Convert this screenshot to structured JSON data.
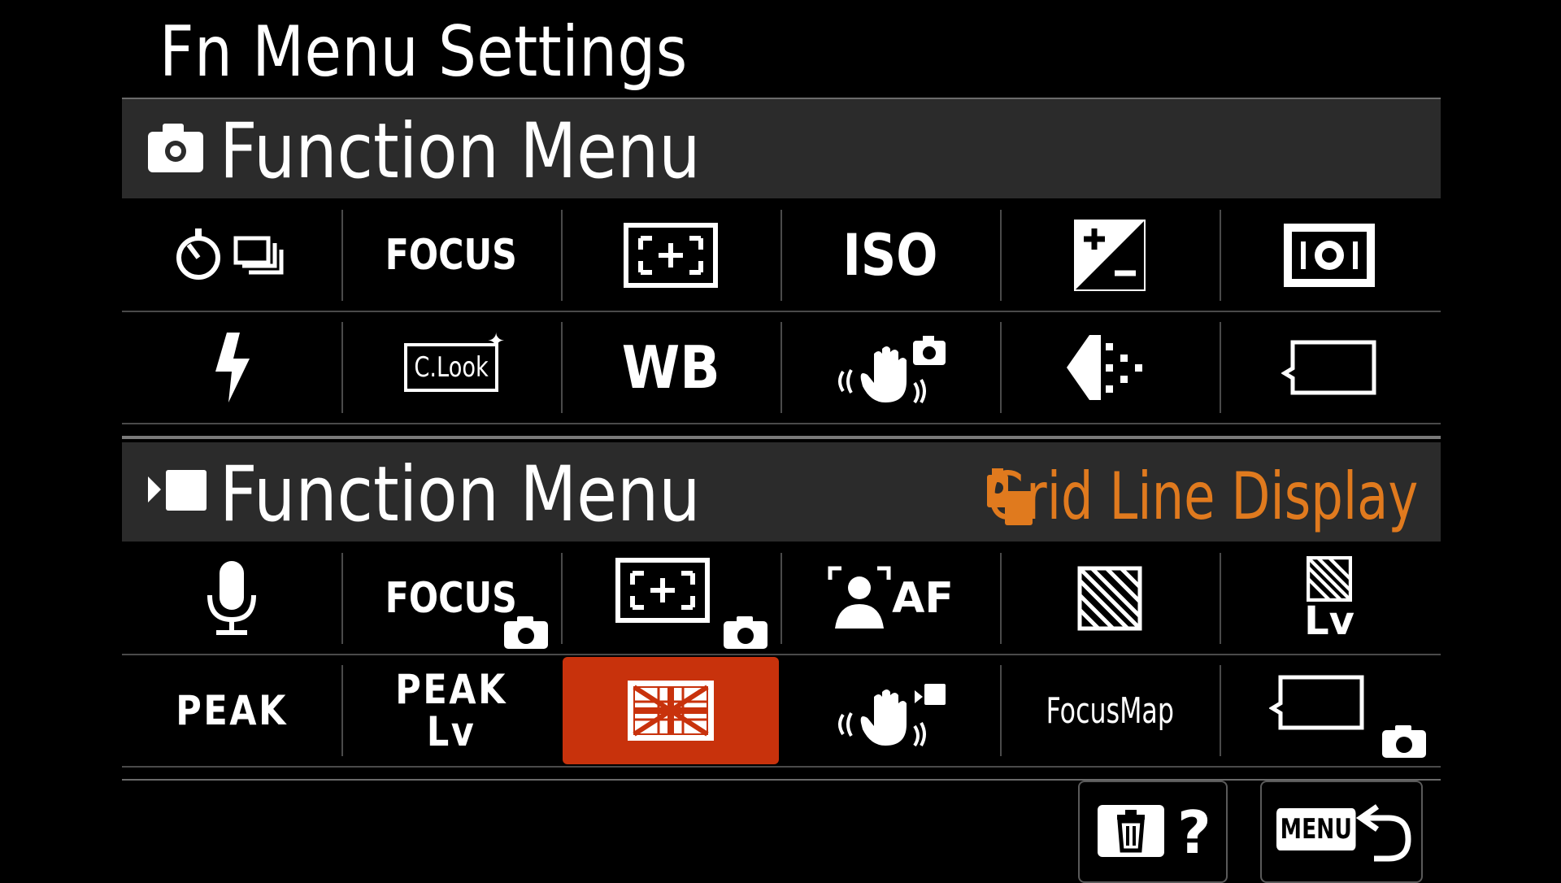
{
  "screen": {
    "title": "Fn Menu Settings"
  },
  "photo_section": {
    "label": "Function Menu",
    "icon": "camera-icon",
    "rows": [
      [
        {
          "name": "drive-mode",
          "icon": "drive-mode-icon"
        },
        {
          "name": "focus-mode",
          "text": "FOCUS"
        },
        {
          "name": "focus-area",
          "icon": "focus-area-icon"
        },
        {
          "name": "iso",
          "text": "ISO"
        },
        {
          "name": "exposure-comp",
          "icon": "exposure-comp-icon"
        },
        {
          "name": "metering-mode",
          "icon": "metering-icon"
        }
      ],
      [
        {
          "name": "flash-mode",
          "icon": "flash-icon"
        },
        {
          "name": "creative-look",
          "text": "C.Look"
        },
        {
          "name": "white-balance",
          "text": "WB"
        },
        {
          "name": "steadyshot-still",
          "icon": "steadyshot-icon"
        },
        {
          "name": "jpeg-quality",
          "icon": "quality-icon"
        },
        {
          "name": "empty-slot",
          "icon": "empty-slot-icon"
        }
      ]
    ]
  },
  "movie_section": {
    "label": "Function Menu",
    "icon": "movie-icon",
    "current_item": "Grid Line Display",
    "current_item_icon": "grid-line-mode-icon",
    "accent": "#e07a1e",
    "rows": [
      [
        {
          "name": "audio-rec",
          "icon": "microphone-icon"
        },
        {
          "name": "focus-mode-still",
          "text": "FOCUS"
        },
        {
          "name": "focus-area-still",
          "icon": "focus-area-icon"
        },
        {
          "name": "face-eye-af",
          "text": "AF"
        },
        {
          "name": "zebra-display",
          "icon": "zebra-icon"
        },
        {
          "name": "zebra-lv",
          "text": "Lv"
        }
      ],
      [
        {
          "name": "peaking",
          "text": "PEAK"
        },
        {
          "name": "peaking-lv",
          "text": "PEAK",
          "text2": "Lv"
        },
        {
          "name": "grid-line",
          "icon": "grid-line-icon",
          "selected": true
        },
        {
          "name": "steadyshot-movie",
          "icon": "steadyshot-icon"
        },
        {
          "name": "focus-map",
          "text": "FocusMap"
        },
        {
          "name": "empty-slot-still",
          "icon": "empty-slot-icon"
        }
      ]
    ]
  },
  "buttons": {
    "delete_help": {
      "icon": "trash-icon",
      "label": "?"
    },
    "menu_back": {
      "badge": "MENU",
      "icon": "back-arrow-icon"
    }
  },
  "colors": {
    "selected": "#c8320c",
    "header_bg": "#2b2b2b",
    "accent": "#e07a1e"
  }
}
